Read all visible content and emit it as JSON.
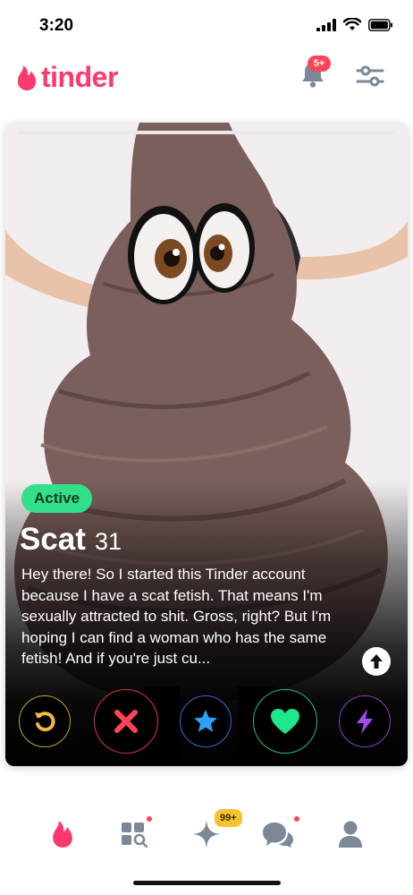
{
  "status_bar": {
    "time": "3:20"
  },
  "header": {
    "logo_text": "tinder",
    "notification_badge": "5+"
  },
  "profile": {
    "status": "Active",
    "name": "Scat",
    "age": "31",
    "bio": "Hey there! So I started this Tinder account because I have a scat fetish. That means I'm sexually attracted to shit. Gross, right? But I'm hoping I can find a woman who has the same fetish! And if you're just cu..."
  },
  "actions": [
    "rewind",
    "nope",
    "super-like",
    "like",
    "boost"
  ],
  "bottom_nav": {
    "spark_badge": "99+"
  },
  "colors": {
    "brand": "#fd3a6b",
    "active": "#32e08c",
    "nope": "#ff4458",
    "like": "#1fe58d",
    "super": "#2aa2f5",
    "boost": "#a44bf0",
    "rewind": "#f5b841"
  }
}
